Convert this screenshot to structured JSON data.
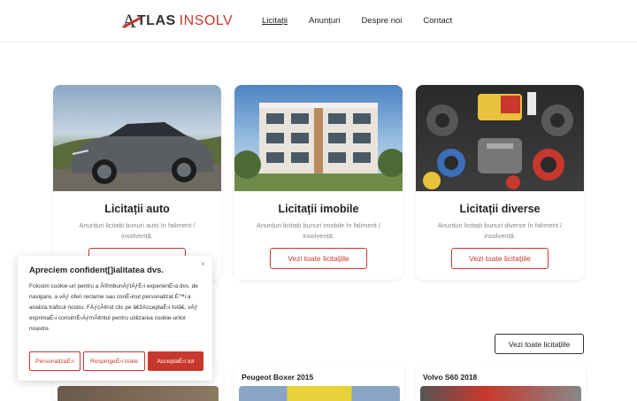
{
  "header": {
    "logo_a": "A",
    "logo_tlas": "TLAS",
    "logo_insolv": "INSOLV",
    "nav": [
      "Licitații",
      "Anunțuri",
      "Despre noi",
      "Contact"
    ]
  },
  "cards": [
    {
      "title": "Licitații auto",
      "desc": "Anunțuri licitații bunuri auto în faliment / insolvență.",
      "button": "Vezi toate licitațiile"
    },
    {
      "title": "Licitații imobile",
      "desc": "Anunțuri licitații bunuri imobile în faliment / insolvență.",
      "button": "Vezi toate licitațiile"
    },
    {
      "title": "Licitații diverse",
      "desc": "Anunțuri licitații bunuri diverse în faliment / insolvență.",
      "button": "Vezi toate licitațiile"
    }
  ],
  "listings": {
    "all_button": "Vezi toate licitațiile",
    "items": [
      {
        "title": ""
      },
      {
        "title": "Peugeot Boxer 2015"
      },
      {
        "title": "Volvo S60 2018"
      }
    ]
  },
  "cookie": {
    "title": "Apreciem confidenț[]ialitatea dvs.",
    "close": "×",
    "text": "Folosim cookie-uri pentru a Ã®mbunÄƒtÄƒÈ›i experienÈ›a dvs. de navigare, a vÄƒ oferi reclame sau conÈ›inut personalizat È™i a analiza traficul nostru. FÄƒcÃ¢nd clic pe â€žAcceptaÈ›i totâ€, vÄƒ exprimaÈ›i consimÈ›ÄƒmÃ¢ntul pentru utilizarea cookie-urilor noastre.",
    "btn_customize": "PersonalizaÈ›i",
    "btn_reject": "RespingeÈ›i toate",
    "btn_accept": "AcceptaÈ›i tot"
  },
  "colors": {
    "accent": "#c8382c"
  }
}
